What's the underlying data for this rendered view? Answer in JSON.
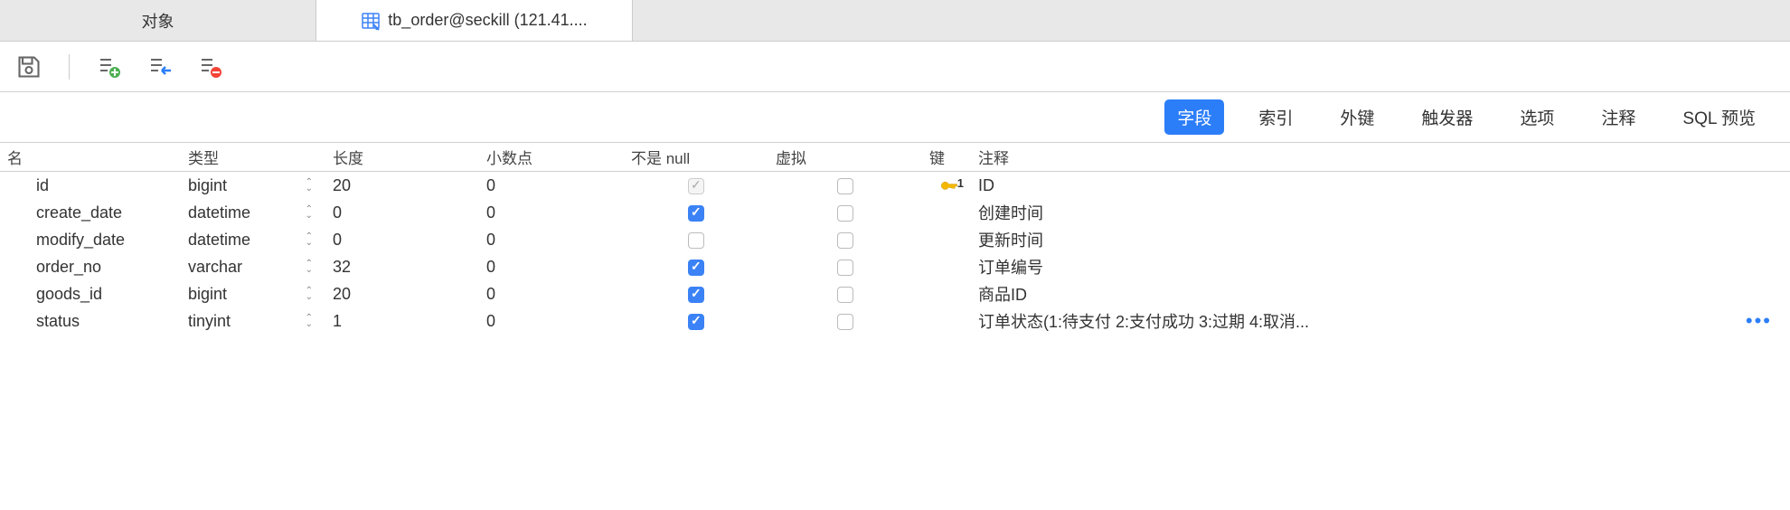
{
  "tabs": {
    "objects": "对象",
    "active": "tb_order@seckill (121.41...."
  },
  "nav": {
    "fields": "字段",
    "indexes": "索引",
    "foreign_keys": "外键",
    "triggers": "触发器",
    "options": "选项",
    "comment": "注释",
    "sql_preview": "SQL 预览"
  },
  "columns": {
    "name": "名",
    "type": "类型",
    "length": "长度",
    "decimal": "小数点",
    "not_null": "不是 null",
    "virtual": "虚拟",
    "key": "键",
    "comment": "注释"
  },
  "rows": [
    {
      "name": "id",
      "type": "bigint",
      "length": "20",
      "decimal": "0",
      "not_null": "checked-disabled",
      "virtual": false,
      "is_key": true,
      "key_num": "1",
      "comment": "ID",
      "more": false
    },
    {
      "name": "create_date",
      "type": "datetime",
      "length": "0",
      "decimal": "0",
      "not_null": "checked",
      "virtual": false,
      "is_key": false,
      "comment": "创建时间",
      "more": false
    },
    {
      "name": "modify_date",
      "type": "datetime",
      "length": "0",
      "decimal": "0",
      "not_null": "",
      "virtual": false,
      "is_key": false,
      "comment": "更新时间",
      "more": false
    },
    {
      "name": "order_no",
      "type": "varchar",
      "length": "32",
      "decimal": "0",
      "not_null": "checked",
      "virtual": false,
      "is_key": false,
      "comment": "订单编号",
      "more": false
    },
    {
      "name": "goods_id",
      "type": "bigint",
      "length": "20",
      "decimal": "0",
      "not_null": "checked",
      "virtual": false,
      "is_key": false,
      "comment": "商品ID",
      "more": false
    },
    {
      "name": "status",
      "type": "tinyint",
      "length": "1",
      "decimal": "0",
      "not_null": "checked",
      "virtual": false,
      "is_key": false,
      "comment": "订单状态(1:待支付 2:支付成功 3:过期 4:取消...",
      "more": true
    }
  ]
}
